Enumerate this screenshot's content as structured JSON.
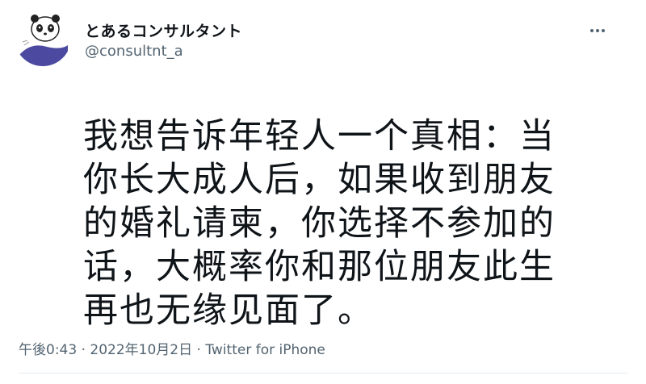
{
  "tweet": {
    "author": {
      "display_name": "とあるコンサルタント",
      "handle": "@consultnt_a",
      "avatar": "panda-avatar-icon"
    },
    "more_icon": "more-horizontal-icon",
    "text": "我想告诉年轻人一个真相：当\n你长大成人后，如果收到朋友\n的婚礼请柬，你选择不参加的\n话，大概率你和那位朋友此生\n再也无缘见面了。",
    "time": "午後0:43",
    "separator": "·",
    "date": "2022年10月2日",
    "source": "Twitter for iPhone"
  },
  "colors": {
    "text_primary": "#0f1419",
    "text_secondary": "#536471",
    "avatar_accent": "#4b4aa0"
  }
}
